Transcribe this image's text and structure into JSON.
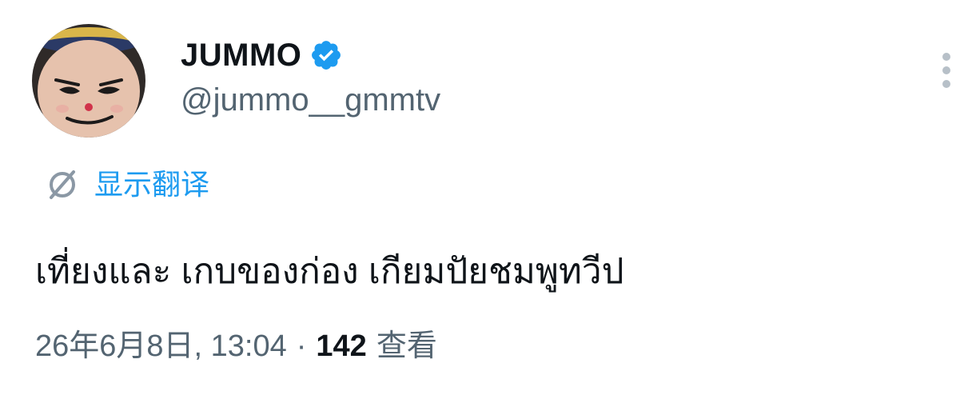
{
  "author": {
    "display_name": "JUMMO",
    "handle": "@jummo__gmmtv",
    "verified": true,
    "avatar_icon": "mascot-avatar",
    "verified_icon": "verified-badge-icon",
    "verified_color": "#1d9bf0"
  },
  "menu": {
    "more_icon": "more-vertical-icon"
  },
  "translate": {
    "label": "显示翻译",
    "icon": "globe-translate-icon",
    "color": "#1d9bf0"
  },
  "tweet": {
    "text": "เที่ยงและ เกบของก่อง เกียมปัยชมพูทวีป"
  },
  "meta": {
    "timestamp": "26年6月8日, 13:04",
    "separator": "·",
    "views_count": "142",
    "views_label": "查看"
  },
  "colors": {
    "text_primary": "#0f1419",
    "text_secondary": "#536471",
    "accent": "#1d9bf0"
  }
}
